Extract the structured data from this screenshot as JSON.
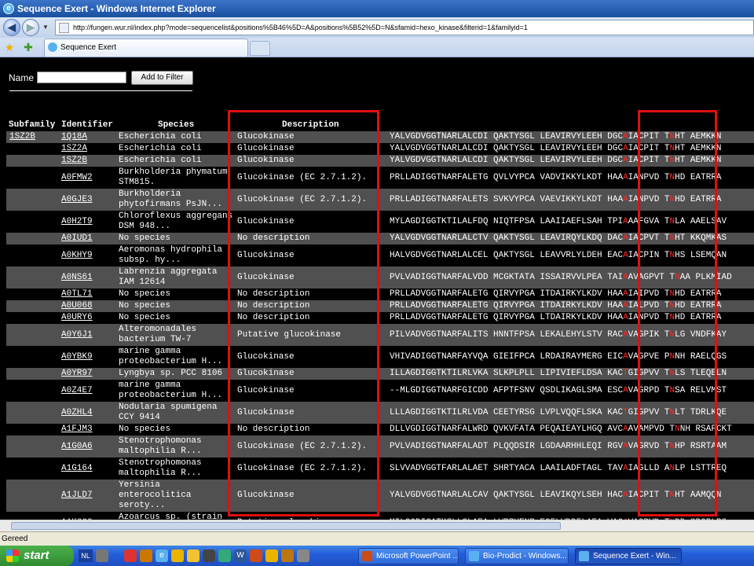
{
  "window": {
    "title": "Sequence Exert - Windows Internet Explorer",
    "url": "http://fungen.wur.nl/index.php?mode=sequencelist&positions%5B46%5D=A&positions%5B52%5D=N&sfamid=hexo_kinase&filterid=1&familyid=1",
    "tab_title": "Sequence Exert",
    "status": "Gereed"
  },
  "filter": {
    "name_label": "Name",
    "name_value": "",
    "button": "Add to Filter"
  },
  "columns": {
    "subfamily": "Subfamily",
    "identifier": "Identifier",
    "species": "Species",
    "description": "Description"
  },
  "rows": [
    {
      "sub": "1SZ2B",
      "id": "1Q18A",
      "sp": "Escherichia coli",
      "desc": "Glucokinase",
      "seq": [
        "YALVGDVGGTNARLALCDI QAKTYSGL LEAVIRVYLEEH DGC",
        "A",
        "I",
        "A",
        "CPIT T",
        "N",
        "HT ",
        "A",
        "EMKKN"
      ],
      "h": 1
    },
    {
      "sub": "",
      "id": "1SZ2A",
      "sp": "Escherichia coli",
      "desc": "Glucokinase",
      "seq": [
        "YALVGDVGGTNARLALCDI QAKTYSGL LEAVIRVYLEEH DGC",
        "A",
        "I",
        "A",
        "CPIT T",
        "N",
        "HT ",
        "A",
        "EMKKN"
      ],
      "h": 1
    },
    {
      "sub": "",
      "id": "1SZ2B",
      "sp": "Escherichia coli",
      "desc": "Glucokinase",
      "seq": [
        "YALVGDVGGTNARLALCDI QAKTYSGL LEAVIRVYLEEH DGC",
        "A",
        "I",
        "A",
        "CPIT T",
        "N",
        "HT ",
        "A",
        "EMKKN"
      ],
      "h": 1
    },
    {
      "sub": "",
      "id": "A0FMW2",
      "sp": "Burkholderia phymatum STM815.",
      "desc": "Glucokinase (EC 2.7.1.2).",
      "seq": [
        "PRLLADIGGTNARFALETG QVLVYPCA VADVIKKYLKDT HAA",
        "A",
        "I",
        "A",
        "NPVD T",
        "N",
        "HD ",
        "E",
        "ATRRA"
      ],
      "h": 2
    },
    {
      "sub": "",
      "id": "A0GJE3",
      "sp": "Burkholderia phytofirmans PsJN...",
      "desc": "Glucokinase (EC 2.7.1.2).",
      "seq": [
        "PRLLADIGGTNARFALETS SVKVYPCA VAEVIKKYLKDT HAA",
        "A",
        "I",
        "A",
        "NPVD T",
        "N",
        "HD ",
        "E",
        "ATRRA"
      ],
      "h": 2
    },
    {
      "sub": "",
      "id": "A0H2T9",
      "sp": "Chloroflexus aggregans DSM 948...",
      "desc": "Glucokinase",
      "seq": [
        "MYLAGDIGGTKTILALFDQ NIQTFPSA LAAIIAEFLSAH TPI",
        "A",
        "A",
        "A",
        "FGVA T",
        "N",
        "LA ",
        "A",
        "AELSAV"
      ],
      "h": 2
    },
    {
      "sub": "",
      "id": "A0IUD1",
      "sp": "No species",
      "desc": "No description",
      "seq": [
        "YALVGDVGGTNARLALCTV QAKTYSGL LEAVIRQYLKDQ DAC",
        "A",
        "I",
        "A",
        "CPVT T",
        "N",
        "HT ",
        "K",
        "KQMKAS"
      ],
      "h": 1
    },
    {
      "sub": "",
      "id": "A0KHY9",
      "sp": "Aeromonas hydrophila subsp. hy...",
      "desc": "Glucokinase",
      "seq": [
        "HALVGDVGGTNARLALCEL QAKTYSGL LEAVVRLYLDEH EAC",
        "A",
        "I",
        "A",
        "CPIN T",
        "N",
        "HS ",
        "L",
        "SEMQAN"
      ],
      "h": 2
    },
    {
      "sub": "",
      "id": "A0NS61",
      "sp": "Labrenzia aggregata IAM 12614",
      "desc": "Glucokinase",
      "seq": [
        "PVLVADIGGTNARFALVDD MCGKTATA ISSAIRVVLPEA TAI",
        "A",
        "A",
        "V",
        "AGPVT T",
        "N",
        "AA ",
        "P",
        "LKMIAD"
      ],
      "h": 2
    },
    {
      "sub": "",
      "id": "A0TL71",
      "sp": "No species",
      "desc": "No description",
      "seq": [
        "PRLLADVGGTNARFALETG QIRVYPGA ITDAIRKYLKDV HAA",
        "A",
        "I",
        "A",
        "IPVD T",
        "N",
        "HD ",
        "E",
        "ATRRA"
      ],
      "h": 1
    },
    {
      "sub": "",
      "id": "A0U068",
      "sp": "No species",
      "desc": "No description",
      "seq": [
        "PRLLADVGGTNARFALETG QIRVYPGA ITDAIRKYLKDV HAA",
        "A",
        "I",
        "A",
        "LPVD T",
        "N",
        "HD ",
        "E",
        "ATRRA"
      ],
      "h": 1
    },
    {
      "sub": "",
      "id": "A0URY6",
      "sp": "No species",
      "desc": "No description",
      "seq": [
        "PRLLADVGGTNARFALETG QIRVYPGA LTDAIRKYLKDV HAA",
        "A",
        "I",
        "A",
        "NPVD T",
        "N",
        "HD ",
        "E",
        "ATRRA"
      ],
      "h": 1
    },
    {
      "sub": "",
      "id": "A0Y6J1",
      "sp": "Alteromonadales bacterium TW-7",
      "desc": "Putative glucokinase",
      "seq": [
        "PILVADVGGTNARFALITS HNNTFPSA LEKALEHYLSTV RAC",
        "A",
        "V",
        "A",
        "GPIK T",
        "N",
        "LG ",
        "V",
        "NDFKAY"
      ],
      "h": 2
    },
    {
      "sub": "",
      "id": "A0YBK9",
      "sp": "marine gamma proteobacterium H...",
      "desc": "Glucokinase",
      "seq": [
        "VHIVADIGGTNARFAYVQA GIEIFPCA LRDAIRAYMERG EIC",
        "A",
        "V",
        "A",
        "GPVE P",
        "N",
        "NH ",
        "R",
        "AELQGS"
      ],
      "h": 2
    },
    {
      "sub": "",
      "id": "A0YR97",
      "sp": "Lyngbya sp. PCC 8106",
      "desc": "Glucokinase",
      "seq": [
        "ILLAGDIGGTKTILRLVKA SLKPLPLL LIPIVIEFLDSA KAC",
        "T",
        "G",
        "I",
        "GPVV T",
        "N",
        "LS ",
        "T",
        "LEQELN"
      ],
      "h": 1
    },
    {
      "sub": "",
      "id": "A0Z4E7",
      "sp": "marine gamma proteobacterium H...",
      "desc": "Glucokinase",
      "seq": [
        "--MLGDIGGTNARFGICDD AFPTFSNV QSDLIKAGLSMA ESC",
        "A",
        "V",
        "A",
        "GRPD T",
        "N",
        "SA ",
        "R",
        "ELVMST"
      ],
      "h": 2
    },
    {
      "sub": "",
      "id": "A0ZHL4",
      "sp": "Nodularia spumigena CCY 9414",
      "desc": "Glucokinase",
      "seq": [
        "LLLAGDIGGTKTILRLVDA CEETYRSG LVPLVQQFLSKA KAC",
        "T",
        "G",
        "I",
        "GPVV T",
        "N",
        "LT ",
        "T",
        "DRLKQE"
      ],
      "h": 2
    },
    {
      "sub": "",
      "id": "A1FJM3",
      "sp": "No species",
      "desc": "No description",
      "seq": [
        "DLLVGDIGGTNARFALWRD QVKVFATA PEQAIEAYLHGQ AVC",
        "A",
        "A",
        "V",
        "AMPVD T",
        "N",
        "NH ",
        "R",
        "SAFCKT"
      ],
      "h": 1
    },
    {
      "sub": "",
      "id": "A1G0A6",
      "sp": "Stenotrophomonas maltophilia R...",
      "desc": "Glucokinase (EC 2.7.1.2).",
      "seq": [
        "PVLVADIGGTNARFALADT PLQQDSIR LGDAARHHLEQI RGV",
        "A",
        "V",
        "A",
        "GRVD T",
        "N",
        "HP ",
        "R",
        "SRTAAM"
      ],
      "h": 2
    },
    {
      "sub": "",
      "id": "A1G164",
      "sp": "Stenotrophomonas maltophilia R...",
      "desc": "Glucokinase (EC 2.7.1.2).",
      "seq": [
        "SLVVADVGGTFARLALAET SHRTYACA LAAILADFTAGL TAV",
        "A",
        "I",
        "A",
        "GLLD A",
        "N",
        "LP ",
        "L",
        "STTREQ"
      ],
      "h": 2
    },
    {
      "sub": "",
      "id": "A1JLD7",
      "sp": "Yersinia enterocolitica seroty...",
      "desc": "Glucokinase",
      "seq": [
        "YALVGDVGGTNARLALCAV QAKTYSGL LEAVIKQYLSEH HAC",
        "A",
        "I",
        "A",
        "CPIT T",
        "N",
        "HT ",
        "A",
        "AMQQN"
      ],
      "h": 3
    },
    {
      "sub": "",
      "id": "A1K6G2",
      "sp": "Azoarcus sp. (strain",
      "desc": "Putative glucokinase",
      "seq": [
        "MILCGDIGATKSLLGLAEA LVRRYENR EGELVDDFLAEA VAG",
        "A",
        "V",
        "A",
        "GPVD T",
        "N",
        "DD ",
        "S",
        "PGPLRS"
      ],
      "h": 2
    }
  ],
  "highlight_color": "#ff2a2a",
  "taskbar": {
    "start": "start",
    "lang": "NL",
    "tasks": [
      "Microsoft PowerPoint ...",
      "Bio-Prodict - Windows...",
      "Sequence Exert - Win..."
    ]
  }
}
